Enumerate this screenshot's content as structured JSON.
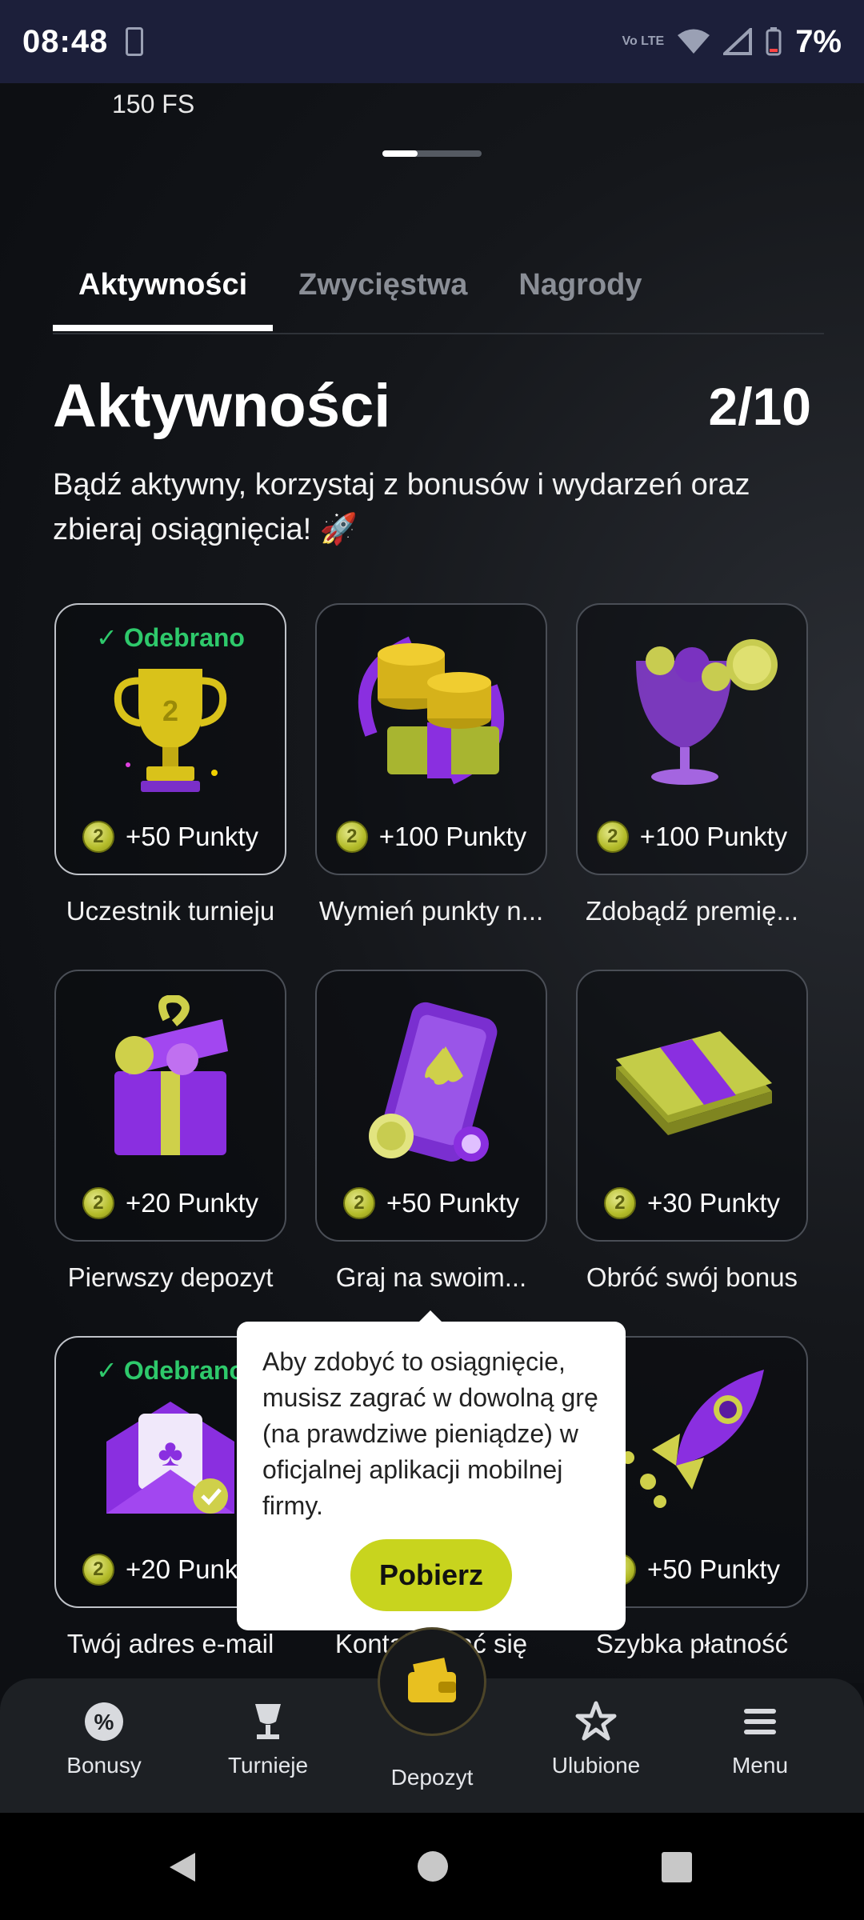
{
  "status_bar": {
    "time": "08:48",
    "network_label": "Vo LTE",
    "battery": "7%"
  },
  "header": {
    "fs_label": "150 FS"
  },
  "tabs": [
    {
      "label": "Aktywności",
      "active": true
    },
    {
      "label": "Zwycięstwa",
      "active": false
    },
    {
      "label": "Nagrody",
      "active": false
    }
  ],
  "section": {
    "title": "Aktywności",
    "progress": "2/10",
    "description": "Bądź aktywny, korzystaj z bonusów i wydarzeń oraz zbieraj osiągnięcia! 🚀"
  },
  "cards": [
    {
      "title": "Uczestnik turnieju",
      "points": "+50 Punkty",
      "claimed_label": "Odebrano",
      "icon": "trophy-icon"
    },
    {
      "title": "Wymień punkty n...",
      "points": "+100 Punkty",
      "claimed_label": "",
      "icon": "coins-exchange-icon"
    },
    {
      "title": "Zdobądź premię...",
      "points": "+100 Punkty",
      "claimed_label": "",
      "icon": "cocktail-glass-icon"
    },
    {
      "title": "Pierwszy depozyt",
      "points": "+20 Punkty",
      "claimed_label": "",
      "icon": "gift-box-icon"
    },
    {
      "title": "Graj na swoim...",
      "points": "+50 Punkty",
      "claimed_label": "",
      "icon": "phone-spade-icon"
    },
    {
      "title": "Obróć swój bonus",
      "points": "+30 Punkty",
      "claimed_label": "",
      "icon": "cash-stack-icon"
    },
    {
      "title": "Twój adres e-mail",
      "points": "+20 Punkty",
      "claimed_label": "Odebrano",
      "icon": "envelope-icon"
    },
    {
      "title": "Kontaktować się",
      "points": "",
      "claimed_label": "",
      "icon": ""
    },
    {
      "title": "Szybka płatność",
      "points": "+50 Punkty",
      "claimed_label": "",
      "icon": "rocket-icon"
    }
  ],
  "tooltip": {
    "text": "Aby zdobyć to osiągnięcie, musisz zagrać w dowolną grę (na prawdziwe pieniądze) w oficjalnej aplikacji mobilnej firmy.",
    "button": "Pobierz"
  },
  "bottom_nav": [
    {
      "label": "Bonusy",
      "icon": "percent-flower-icon"
    },
    {
      "label": "Turnieje",
      "icon": "trophy-cup-icon"
    },
    {
      "label": "Depozyt",
      "icon": "wallet-icon"
    },
    {
      "label": "Ulubione",
      "icon": "star-icon"
    },
    {
      "label": "Menu",
      "icon": "hamburger-icon"
    }
  ],
  "colors": {
    "accent": "#c8d41e",
    "claimed": "#2ec96b",
    "statusbar": "#1c1f3a",
    "background": "#0d0f13"
  }
}
